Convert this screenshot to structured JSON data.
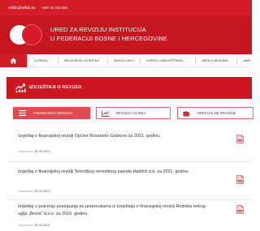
{
  "topbar": {
    "email": "vrifbih@vrifbih.ba",
    "phone": "+387 33 723 550"
  },
  "header": {
    "title_line1": "URED ZA REVIZIJU INSTITUCIJA",
    "title_line2": "U FEDERACIJI BOSNE I HERCEGOVINE"
  },
  "nav": {
    "items": [
      "O UREDU",
      "REVIZORSKI IZVJEŠTAJI",
      "ZAKONI I AKTI",
      "VIJESTI I OBAVJEŠTENJA",
      "URED U MEDIJIMA",
      "JAVN"
    ]
  },
  "banner": {
    "title": "IZVJEŠTAJI O REVIZIJI"
  },
  "tabs": [
    {
      "label": "FINANSIJSKA REVIZIJA"
    },
    {
      "label": "REVIZIJA UČINKA"
    },
    {
      "label": "SPECIJALNE REVIZIJE"
    }
  ],
  "reports": [
    {
      "title": "Izvještaj o finansijskoj reviziji Općine Bosansko Grahovo za 2021. godinu.",
      "published_label": "Objavljeno:",
      "date": "30.05.2022"
    },
    {
      "title": "Izvještaj o finansijskoj reviziji Tehničkog remontnog zavoda Hadžići d.d. za 2021. godinu.",
      "published_label": "Objavljeno:",
      "date": "30.05.2022"
    },
    {
      "title": "Izvještaj o praćenju postupanja po preporukama iz Izvještaja o finansijskoj reviziji Rudnika mrkog uglja „Breza“ d.o.o. za 2016. godinu.",
      "published_label": "Objavljeno:",
      "date": "30.05.2022"
    }
  ],
  "colors": {
    "brand_red": "#c6161f",
    "tab_active": "#de4a50",
    "pdf_red": "#e05a5f"
  }
}
